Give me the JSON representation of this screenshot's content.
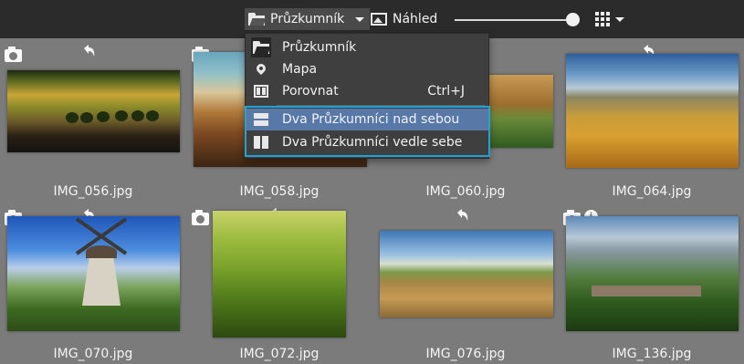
{
  "toolbar": {
    "explorer_label": "Průzkumník",
    "preview_label": "Náhled"
  },
  "menu": {
    "items": [
      {
        "label": "Průzkumník",
        "icon": "folder-icon",
        "shortcut": ""
      },
      {
        "label": "Mapa",
        "icon": "map-pin-icon",
        "shortcut": ""
      },
      {
        "label": "Porovnat",
        "icon": "compare-icon",
        "shortcut": "Ctrl+J"
      },
      {
        "label": "Dva Průzkumníci nad sebou",
        "icon": "split-horizontal-icon",
        "shortcut": ""
      },
      {
        "label": "Dva Průzkumníci vedle sebe",
        "icon": "split-vertical-icon",
        "shortcut": ""
      }
    ]
  },
  "thumbnails": [
    {
      "filename": "IMG_056.jpg"
    },
    {
      "filename": "IMG_058.jpg"
    },
    {
      "filename": "IMG_060.jpg"
    },
    {
      "filename": "IMG_064.jpg"
    },
    {
      "filename": "IMG_070.jpg"
    },
    {
      "filename": "IMG_072.jpg"
    },
    {
      "filename": "IMG_076.jpg"
    },
    {
      "filename": "IMG_136.jpg"
    }
  ],
  "colors": {
    "background": "#7b7b7b",
    "toolbar": "#2b2b2b",
    "menu": "#3f3f3f",
    "menu_selected": "#5878a8",
    "highlight_border": "#1fa3d4"
  }
}
